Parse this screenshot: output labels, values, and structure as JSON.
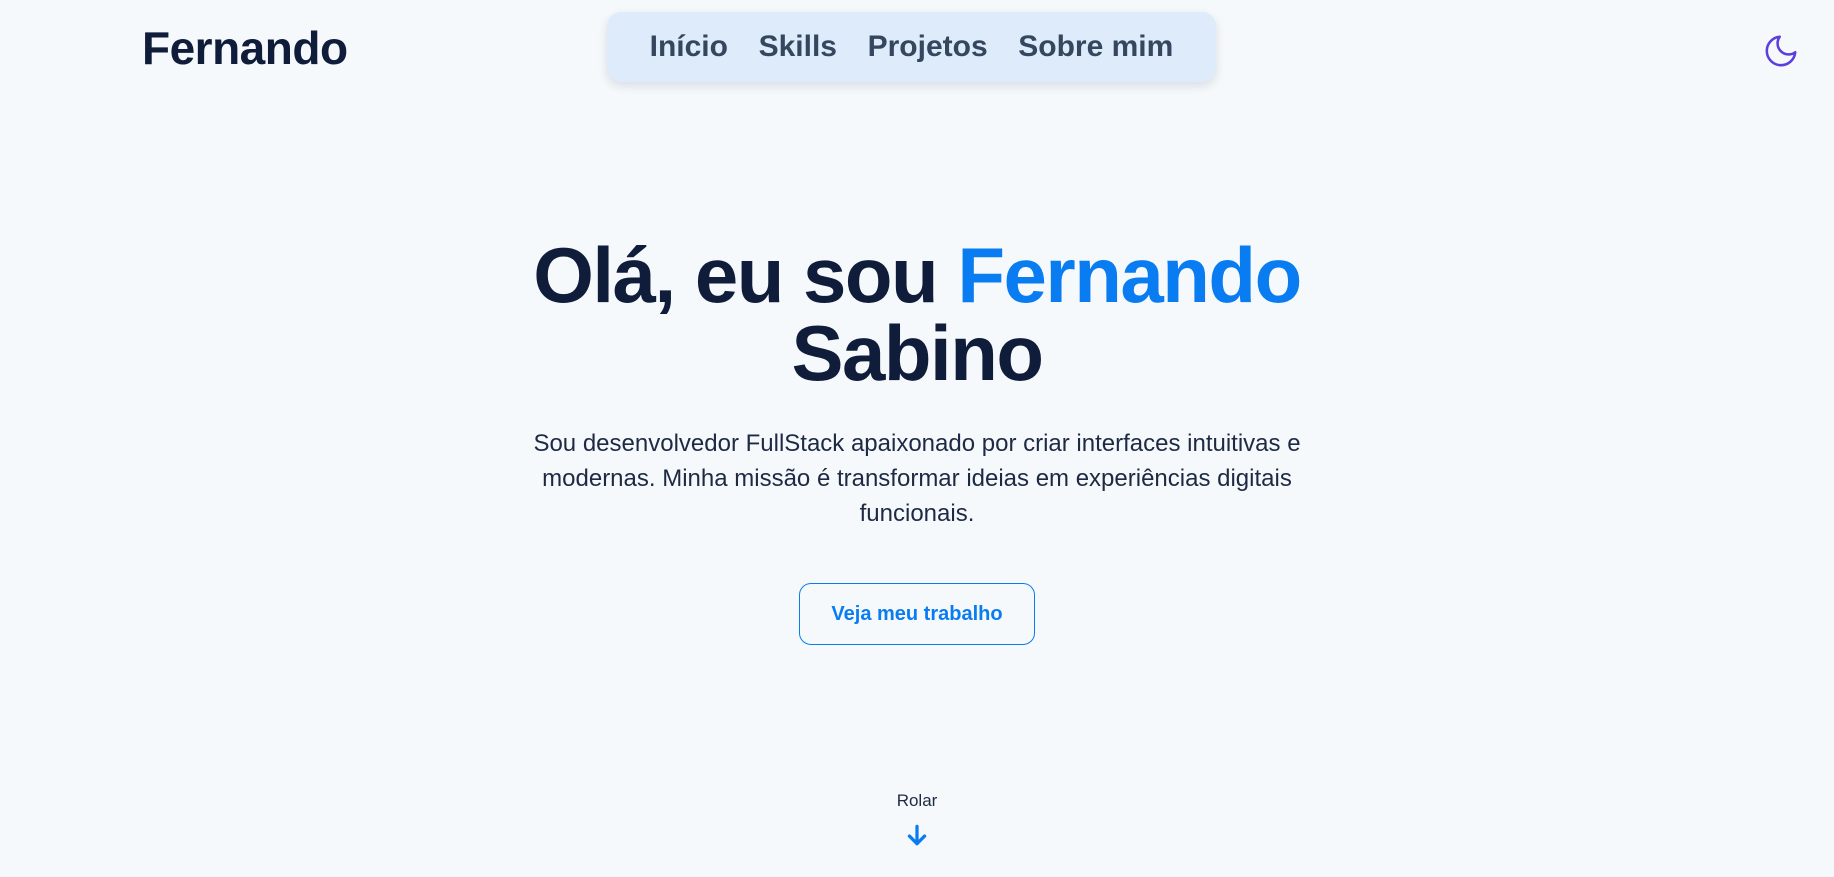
{
  "header": {
    "brand": "Fernando",
    "nav": [
      {
        "label": "Início"
      },
      {
        "label": "Skills"
      },
      {
        "label": "Projetos"
      },
      {
        "label": "Sobre mim"
      }
    ],
    "theme_toggle_icon": "moon-icon"
  },
  "hero": {
    "title_prefix": "Olá, eu sou ",
    "title_accent": "Fernando",
    "title_suffix": "Sabino",
    "subtitle": "Sou desenvolvedor FullStack apaixonado por criar interfaces intuitivas e modernas. Minha missão é transformar ideias em experiências digitais funcionais.",
    "cta_label": "Veja meu trabalho"
  },
  "scroll": {
    "label": "Rolar",
    "icon": "arrow-down-icon"
  },
  "colors": {
    "background": "#f6f9fb",
    "text": "#0f1c3a",
    "accent": "#0a7cf2",
    "nav_bg": "#deebfa",
    "moon": "#5b3ee0"
  }
}
